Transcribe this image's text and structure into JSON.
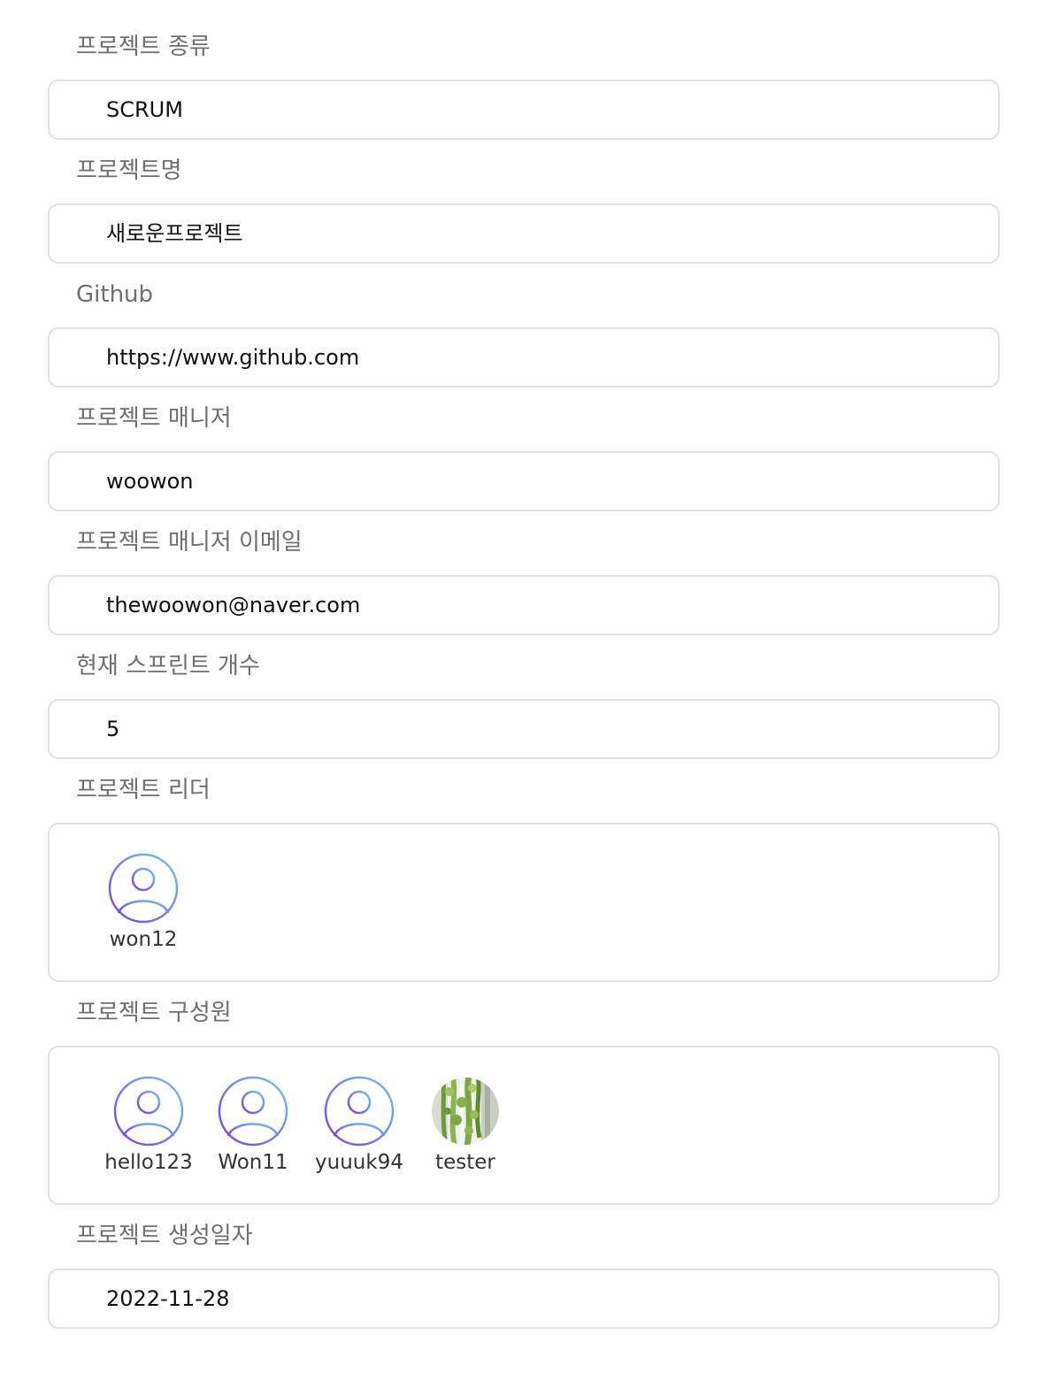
{
  "fields": {
    "type": {
      "label": "프로젝트 종류",
      "value": "SCRUM"
    },
    "name": {
      "label": "프로젝트명",
      "value": "새로운프로젝트"
    },
    "github": {
      "label": "Github",
      "value": "https://www.github.com"
    },
    "manager": {
      "label": "프로젝트 매니저",
      "value": "woowon"
    },
    "manager_email": {
      "label": "프로젝트 매니저 이메일",
      "value": "thewoowon@naver.com"
    },
    "sprint_count": {
      "label": "현재 스프린트 개수",
      "value": "5"
    },
    "leader": {
      "label": "프로젝트 리더"
    },
    "members": {
      "label": "프로젝트 구성원"
    },
    "created_date": {
      "label": "프로젝트 생성일자",
      "value": "2022-11-28"
    }
  },
  "leader": [
    {
      "username": "won12",
      "avatar": "default-user-icon"
    }
  ],
  "members": [
    {
      "username": "hello123",
      "avatar": "default-user-icon"
    },
    {
      "username": "Won11",
      "avatar": "default-user-icon"
    },
    {
      "username": "yuuuk94",
      "avatar": "default-user-icon"
    },
    {
      "username": "tester",
      "avatar": "plant-photo"
    }
  ],
  "colors": {
    "label": "#6e6e73",
    "value": "#111111",
    "border": "#e1e1e4",
    "avatar_gradient_start": "#7b3fe4",
    "avatar_gradient_end": "#6ec6f0"
  }
}
